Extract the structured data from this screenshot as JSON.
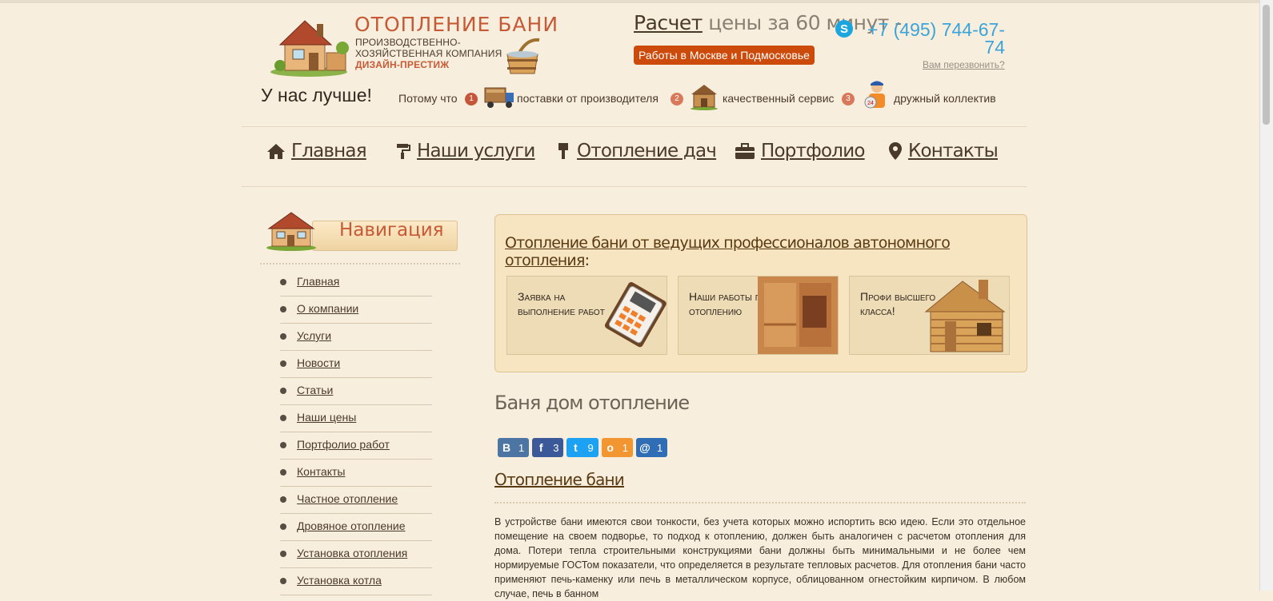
{
  "header": {
    "logo_title": "ОТОПЛЕНИЕ БАНИ",
    "logo_sub1": "ПРОИЗВОДСТВЕННО-",
    "logo_sub2": "ХОЗЯЙСТВЕННАЯ КОМПАНИЯ",
    "logo_brand": "ДИЗАЙН-ПРЕСТИЖ",
    "calc_link": "Расчет",
    "calc_rest": " цены за 60 минут -",
    "moscow_button": "Работы в Москве и Подмосковье",
    "phone": "+7 (495) 744-67-74",
    "callback": "Вам перезвонить?"
  },
  "tagline": {
    "better": "У нас лучше!",
    "because": "Потому что",
    "features": [
      {
        "num": "1",
        "label": "поставки от производителя"
      },
      {
        "num": "2",
        "label": "качественный сервис"
      },
      {
        "num": "3",
        "label": "дружный коллектив"
      }
    ]
  },
  "menu": {
    "items": [
      {
        "label": "Главная",
        "icon": "home-icon"
      },
      {
        "label": "Наши услуги",
        "icon": "paint-roller-icon"
      },
      {
        "label": "Отопление дач",
        "icon": "brush-icon"
      },
      {
        "label": "Портфолио",
        "icon": "briefcase-icon"
      },
      {
        "label": "Контакты",
        "icon": "map-marker-icon"
      }
    ]
  },
  "sidebar": {
    "title": "Навигация",
    "items": [
      {
        "label": "Главная"
      },
      {
        "label": "О компании"
      },
      {
        "label": "Услуги"
      },
      {
        "label": "Новости"
      },
      {
        "label": "Статьи"
      },
      {
        "label": "Наши цены"
      },
      {
        "label": "Портфолио работ"
      },
      {
        "label": "Контакты"
      },
      {
        "label": "Частное отопление"
      },
      {
        "label": "Дровяное отопление"
      },
      {
        "label": "Установка отопления"
      },
      {
        "label": "Установка котла"
      }
    ]
  },
  "feature_box": {
    "title_link": "Отопление бани от ведущих профессионалов автономного отопления",
    "title_colon": ":",
    "cards": [
      {
        "text": "Заявка на выполнение работ"
      },
      {
        "text": "Наши работы по отоплению"
      },
      {
        "text": "Профи высшего класса!"
      }
    ]
  },
  "content": {
    "page_title": "Баня дом отопление",
    "shares": [
      {
        "network": "vk",
        "glyph": "В",
        "count": "1",
        "color": "#4c75a3"
      },
      {
        "network": "facebook",
        "glyph": "f",
        "count": "3",
        "color": "#3b5998"
      },
      {
        "network": "twitter",
        "glyph": "t",
        "count": "9",
        "color": "#1da1f2"
      },
      {
        "network": "odnoklassniki",
        "glyph": "о",
        "count": "1",
        "color": "#f29632"
      },
      {
        "network": "mailru",
        "glyph": "@",
        "count": "1",
        "color": "#2f6db5"
      }
    ],
    "section_title": "Отопление бани",
    "paragraph": "В устройстве бани имеются свои тонкости, без учета которых можно испортить всю идею. Если это отдельное помещение на своем подворье, то подход к отоплению, должен быть аналогичен с расчетом отопления для дома. Потери тепла строительными конструкциями бани должны быть минимальными и не более чем нормируемые ГОСТом показатели, что определяется в результате тепловых расчетов. Для отопления бани часто применяют печь-каменку или печь в металлическом корпусе, облицованном огнестойким кирпичом. В любом случае, печь в банном"
  }
}
